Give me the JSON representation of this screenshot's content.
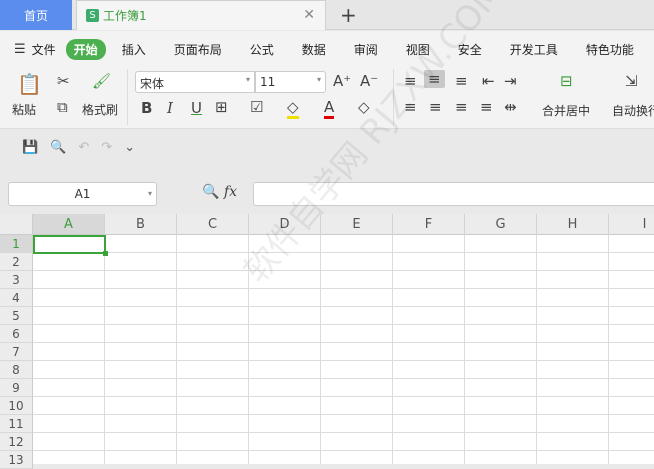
{
  "tabs": {
    "home": "首页",
    "document": "工作簿1",
    "doc_icon": "S"
  },
  "menu": {
    "items": [
      "文件",
      "开始",
      "插入",
      "页面布局",
      "公式",
      "数据",
      "审阅",
      "视图",
      "安全",
      "开发工具",
      "特色功能"
    ],
    "active": "开始"
  },
  "ribbon": {
    "paste": "粘贴",
    "format_painter": "格式刷",
    "font_name": "宋体",
    "font_size": "11",
    "bold": "B",
    "italic": "I",
    "underline": "U",
    "merge_center": "合并居中",
    "auto_wrap": "自动换行"
  },
  "formula_bar": {
    "name_box": "A1",
    "fx": "fx",
    "value": ""
  },
  "sheet": {
    "columns": [
      "A",
      "B",
      "C",
      "D",
      "E",
      "F",
      "G",
      "H",
      "I"
    ],
    "rows": [
      "1",
      "2",
      "3",
      "4",
      "5",
      "6",
      "7",
      "8",
      "9",
      "10",
      "11",
      "12",
      "13"
    ],
    "active_cell": "A1"
  },
  "watermark": "软件自学网 RJZXW.COM",
  "colors": {
    "accent": "#4caf50",
    "home_tab": "#5b8def"
  }
}
